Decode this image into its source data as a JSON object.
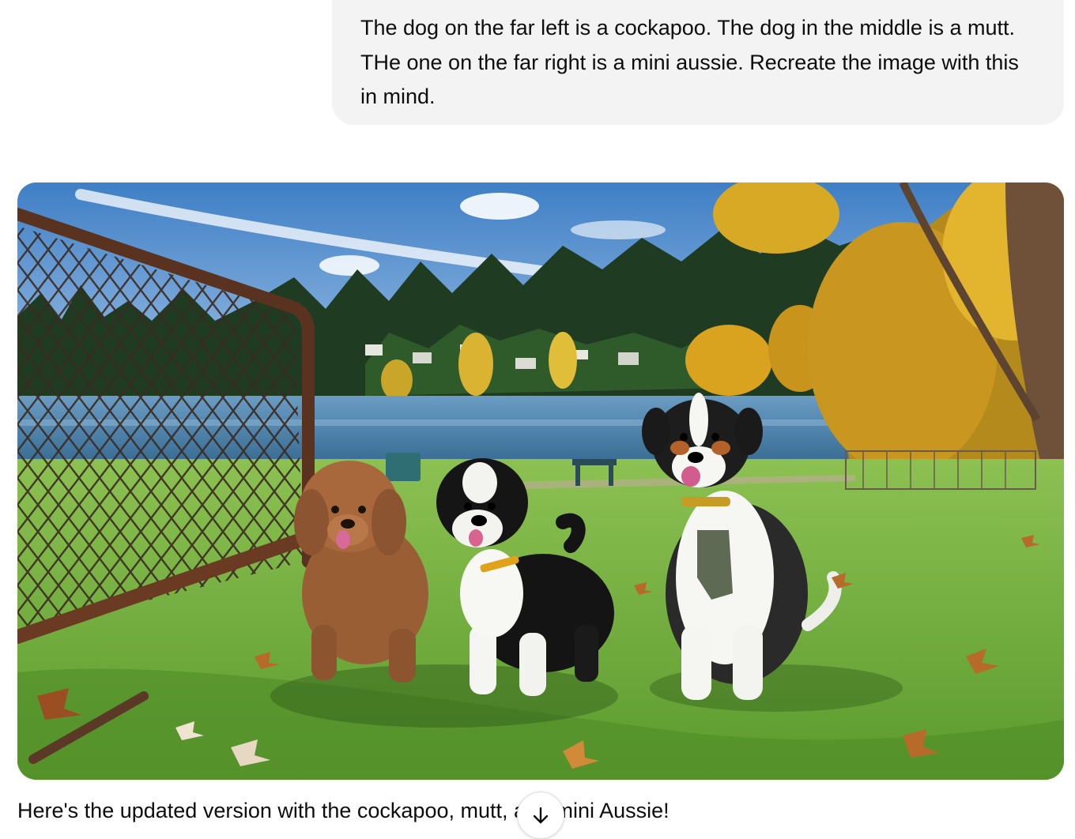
{
  "conversation": {
    "user_message": "The dog on the far left is a cockapoo. The dog in the middle is a mutt. THe one on the far right is a mini aussie. Recreate the image with this in mind.",
    "generated_image": {
      "icon": "generated-image-photo",
      "colors": {
        "sky": "#5f95cf",
        "grass": "#7bb14a",
        "lake": "#4f86b0",
        "autumn": "#d9a21f"
      }
    },
    "assistant_reply": "Here's the updated version with the cockapoo, mutt, and mini Aussie!"
  },
  "scroll_button": {
    "icon": "arrow-down-icon"
  }
}
